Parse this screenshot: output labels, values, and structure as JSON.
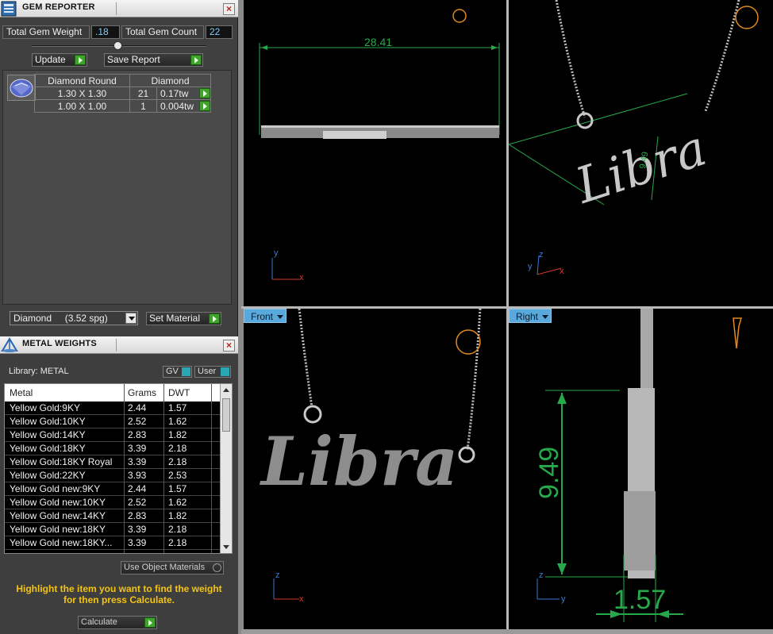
{
  "gem_reporter": {
    "title": "GEM REPORTER",
    "total_weight_label": "Total Gem Weight",
    "total_weight_value": ".18",
    "total_count_label": "Total Gem Count",
    "total_count_value": "22",
    "update_label": "Update",
    "save_report_label": "Save Report",
    "table": {
      "headers": [
        "Diamond Round",
        "Diamond"
      ],
      "rows": [
        {
          "size": "1.30 X 1.30",
          "count": "21",
          "weight": "0.17tw"
        },
        {
          "size": "1.00 X 1.00",
          "count": "1",
          "weight": "0.004tw"
        }
      ]
    },
    "material_select": "Diamond     (3.52 spg)",
    "set_material_label": "Set Material"
  },
  "metal_weights": {
    "title": "METAL WEIGHTS",
    "library_label": "Library: METAL",
    "gv_label": "GV",
    "user_label": "User",
    "columns": [
      "Metal",
      "Grams",
      "DWT"
    ],
    "rows": [
      {
        "metal": "Yellow Gold:9KY",
        "grams": "2.44",
        "dwt": "1.57"
      },
      {
        "metal": "Yellow Gold:10KY",
        "grams": "2.52",
        "dwt": "1.62"
      },
      {
        "metal": "Yellow Gold:14KY",
        "grams": "2.83",
        "dwt": "1.82"
      },
      {
        "metal": "Yellow Gold:18KY",
        "grams": "3.39",
        "dwt": "2.18"
      },
      {
        "metal": "Yellow Gold:18KY Royal",
        "grams": "3.39",
        "dwt": "2.18"
      },
      {
        "metal": "Yellow Gold:22KY",
        "grams": "3.93",
        "dwt": "2.53"
      },
      {
        "metal": "Yellow Gold new:9KY",
        "grams": "2.44",
        "dwt": "1.57"
      },
      {
        "metal": "Yellow Gold new:10KY",
        "grams": "2.52",
        "dwt": "1.62"
      },
      {
        "metal": "Yellow Gold new:14KY",
        "grams": "2.83",
        "dwt": "1.82"
      },
      {
        "metal": "Yellow Gold new:18KY",
        "grams": "3.39",
        "dwt": "2.18"
      },
      {
        "metal": "Yellow Gold new:18KY...",
        "grams": "3.39",
        "dwt": "2.18"
      }
    ],
    "use_object_materials_label": "Use Object Materials",
    "hint_line1": "Highlight the item you want to find the weight",
    "hint_line2": "for then press Calculate.",
    "calculate_label": "Calculate"
  },
  "viewports": {
    "front_label": "Front",
    "right_label": "Right",
    "top_dimension": "28.41",
    "right_height_dimension": "9.49",
    "right_width_dimension": "1.57",
    "persp_dimension_a": "9.49",
    "model_text": "Libra",
    "axis_x": "x",
    "axis_y": "y",
    "axis_z": "z"
  },
  "colors": {
    "dimension_green": "#27a84a",
    "hint_yellow": "#f3c412",
    "viewport_label_blue": "#5aa9dc",
    "axis_red": "#d23a2a",
    "axis_blue": "#3a7cd2"
  }
}
